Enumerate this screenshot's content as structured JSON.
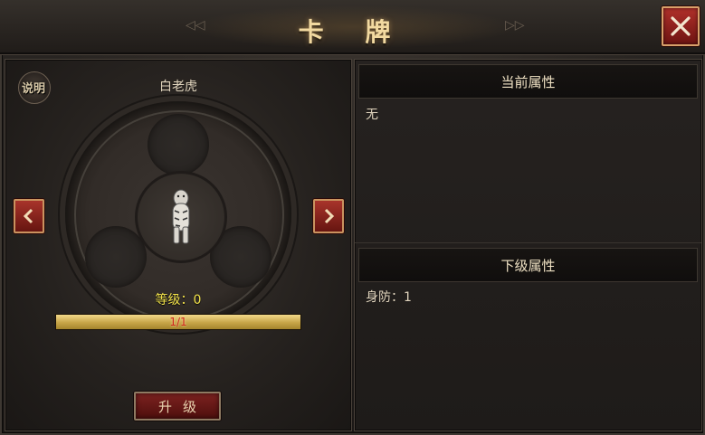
{
  "window": {
    "title": "卡 牌"
  },
  "card": {
    "name": "白老虎",
    "explain_label": "说明",
    "level_text": "等级：0",
    "progress_text": "1/1",
    "progress_fraction": 1.0,
    "upgrade_label": "升级"
  },
  "current_attr": {
    "header": "当前属性",
    "value": "无"
  },
  "next_attr": {
    "header": "下级属性",
    "value": "身防：1"
  },
  "icons": {
    "close": "close-icon",
    "prev": "chevron-left-icon",
    "next": "chevron-right-icon",
    "explain": "explain-badge-icon",
    "tiger": "white-tiger-icon"
  },
  "colors": {
    "title": "#f2d9a0",
    "level": "#f2e24a",
    "progress_text": "#d0241c",
    "button_red": "#7d2220"
  }
}
